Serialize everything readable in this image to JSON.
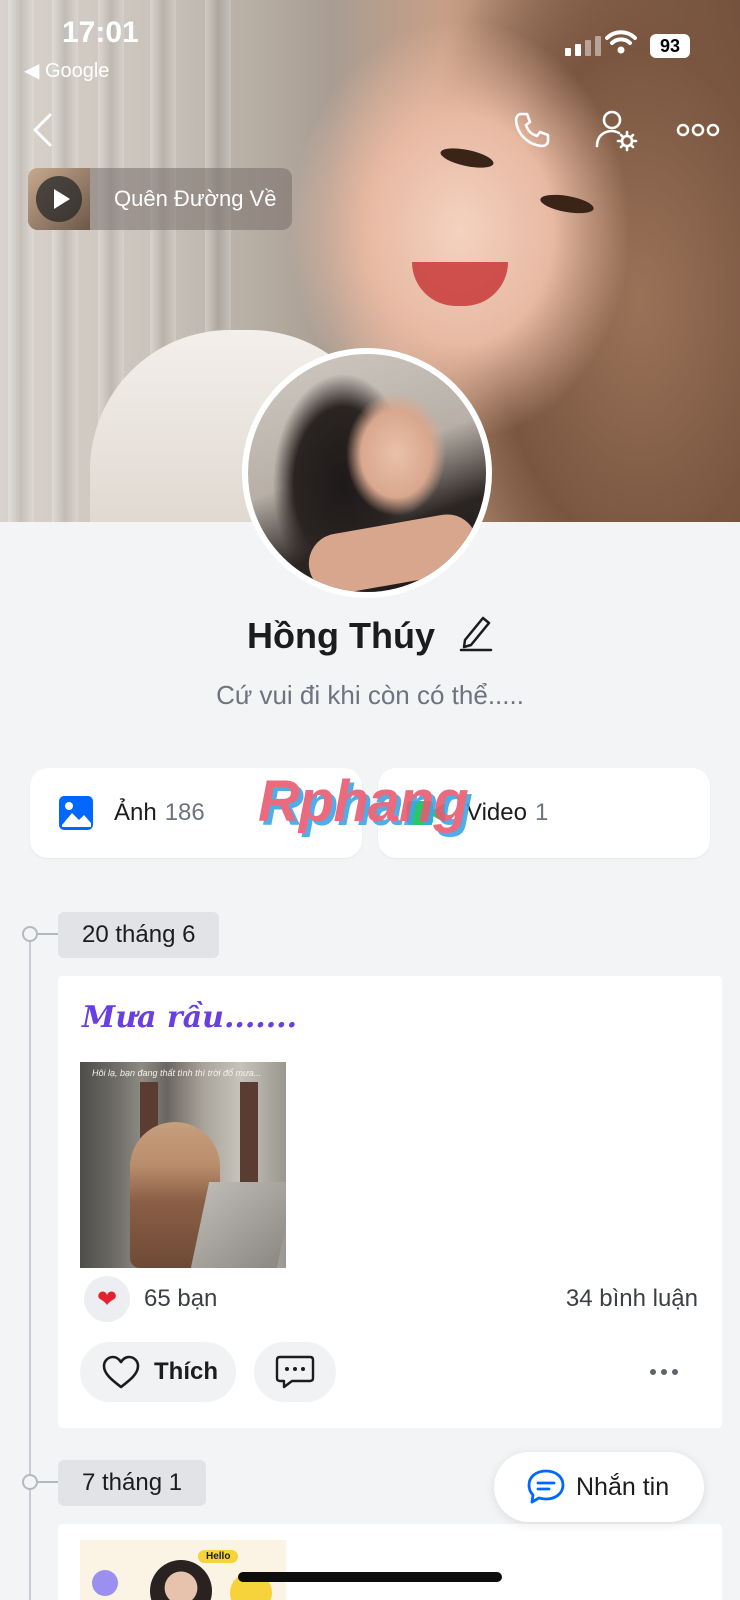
{
  "status_bar": {
    "time": "17:01",
    "back_app": "◀ Google",
    "battery": "93"
  },
  "cover": {
    "music_title": "Quên Đường Về"
  },
  "profile": {
    "name": "Hồng Thúy",
    "bio": "Cứ vui đi khi còn có thể....."
  },
  "media": {
    "photos": {
      "label": "Ảnh",
      "count": "186"
    },
    "videos": {
      "label": "Video",
      "count": "1"
    }
  },
  "watermark": "Rphang",
  "timeline": [
    {
      "date": "20 tháng 6",
      "title": "Mưa rầu.......",
      "photo_caption": "Hôi lạ, bạn đang thất tình thì trời đổ mưa...",
      "reactions": "65 bạn",
      "comments": "34 bình luận",
      "like_label": "Thích"
    },
    {
      "date": "7 tháng 1",
      "image_text": "Hello"
    }
  ],
  "message_button": "Nhắn tin",
  "colors": {
    "accent": "#0068ff",
    "title_purple": "#6a3fe0",
    "heart": "#e2232c",
    "video_green": "#2bc66a"
  }
}
